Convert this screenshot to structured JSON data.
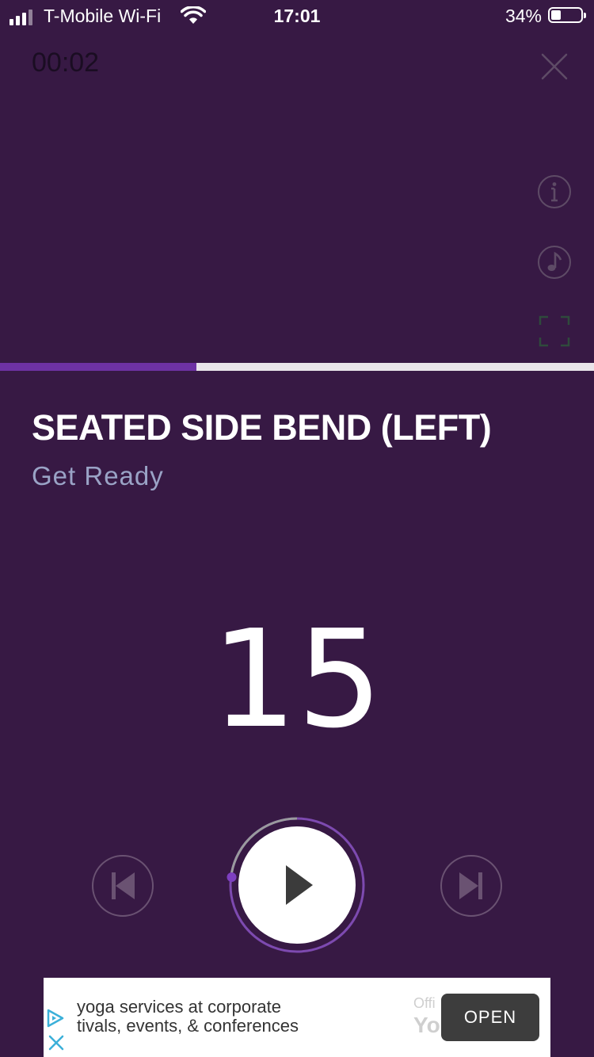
{
  "status_bar": {
    "carrier": "T-Mobile Wi-Fi",
    "time": "17:01",
    "battery_percent": "34%",
    "battery_level": 0.34
  },
  "workout": {
    "elapsed_time": "00:02",
    "progress": 0.33,
    "exercise_title": "SEATED SIDE BEND (LEFT)",
    "exercise_status": "Get Ready",
    "countdown": "15"
  },
  "icons": {
    "close": "close-icon",
    "info": "info-icon",
    "music": "music-note-icon",
    "fullscreen": "fullscreen-icon",
    "previous": "skip-previous-icon",
    "play": "play-icon",
    "next": "skip-next-icon"
  },
  "colors": {
    "background": "#371944",
    "accent": "#6e32a4",
    "subtitle": "#9aa3c6"
  },
  "ad": {
    "line1": "yoga services at corporate",
    "line2": "tivals, events, & conferences",
    "faint_line1": "Offi",
    "faint_line2": "Yo",
    "open_label": "OPEN"
  }
}
